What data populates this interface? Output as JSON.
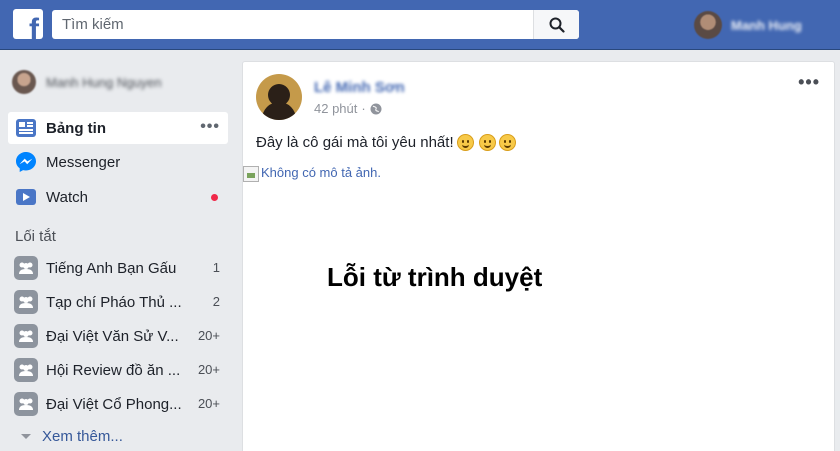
{
  "header": {
    "logo": "f",
    "search_placeholder": "Tìm kiếm",
    "user_name": "Manh Hung"
  },
  "sidebar": {
    "profile_name": "Manh Hung Nguyen",
    "nav": [
      {
        "label": "Bảng tin",
        "icon": "news-feed-icon"
      },
      {
        "label": "Messenger",
        "icon": "messenger-icon"
      },
      {
        "label": "Watch",
        "icon": "watch-icon"
      }
    ],
    "more_dots": "•••",
    "shortcuts_title": "Lối tắt",
    "shortcuts": [
      {
        "label": "Tiếng Anh Bạn Gấu",
        "count": "1"
      },
      {
        "label": "Tạp chí Pháo Thủ ...",
        "count": "2"
      },
      {
        "label": "Đại Việt Văn Sử V...",
        "count": "20+"
      },
      {
        "label": "Hội Review đồ ăn ...",
        "count": "20+"
      },
      {
        "label": "Đại Việt Cổ Phong...",
        "count": "20+"
      }
    ],
    "see_more": "Xem thêm..."
  },
  "post": {
    "author": "Lê Minh Sơn",
    "time": "42 phút",
    "separator": "·",
    "text": "Đây là cô gái mà tôi yêu nhất!",
    "menu": "•••",
    "image_alt": "Không có mô tả ảnh.",
    "caption": "Lỗi từ trình duyệt"
  },
  "colors": {
    "topbar": "#4267b2",
    "link": "#365899",
    "notification": "#f02849"
  }
}
